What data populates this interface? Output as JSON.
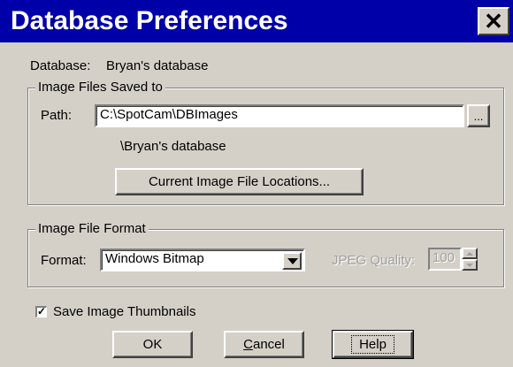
{
  "window": {
    "title": "Database Preferences",
    "close_icon": "close-icon",
    "colors": {
      "titlebar": "#0000a8",
      "face": "#d4d0c8"
    }
  },
  "database": {
    "label": "Database:",
    "value": "Bryan's database"
  },
  "image_files": {
    "group_label": "Image Files Saved to",
    "path_label": "Path:",
    "path_value": "C:\\SpotCam\\DBImages",
    "browse_label": "...",
    "subfolder": "\\Bryan's database",
    "locations_button": "Current Image File Locations..."
  },
  "image_format": {
    "group_label": "Image File Format",
    "format_label": "Format:",
    "format_value": "Windows Bitmap",
    "jpeg_label": "JPEG Quality:",
    "jpeg_value": "100"
  },
  "thumbnails": {
    "label": "Save Image Thumbnails",
    "checked": true
  },
  "buttons": {
    "ok": "OK",
    "cancel_prefix": "",
    "cancel_mnemonic": "C",
    "cancel_rest": "ancel",
    "help": "Help"
  }
}
